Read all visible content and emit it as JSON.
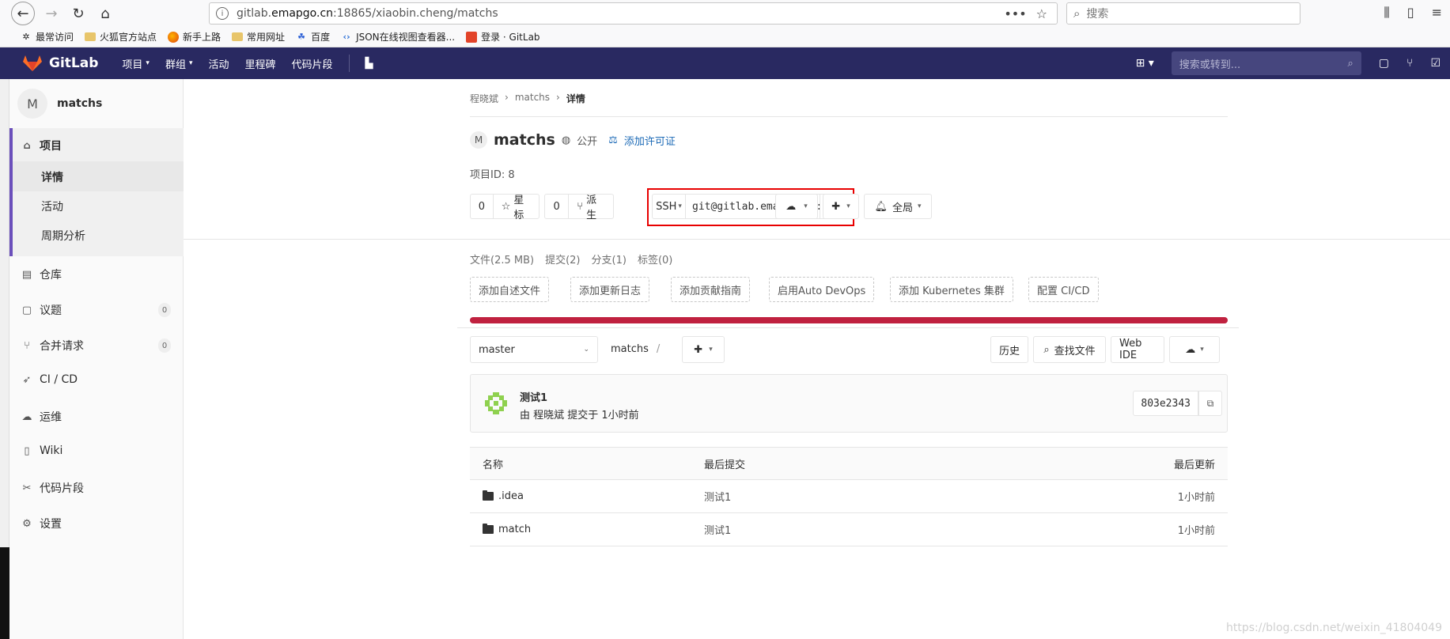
{
  "browser": {
    "url_prefix": "gitlab.",
    "url_host": "emapgo.cn",
    "url_rest": ":18865/xiaobin.cheng/matchs",
    "search_placeholder": "搜索",
    "bookmarks": [
      "最常访问",
      "火狐官方站点",
      "新手上路",
      "常用网址",
      "百度",
      "JSON在线视图查看器...",
      "登录 · GitLab"
    ]
  },
  "gitlab": {
    "brand": "GitLab",
    "menu": [
      "项目",
      "群组",
      "活动",
      "里程碑",
      "代码片段"
    ],
    "search_placeholder": "搜索或转到..."
  },
  "sidebar": {
    "project_initial": "M",
    "project_name": "matchs",
    "section": "项目",
    "sub_items": [
      "详情",
      "活动",
      "周期分析"
    ],
    "items": [
      {
        "label": "仓库"
      },
      {
        "label": "议题",
        "count": "0"
      },
      {
        "label": "合并请求",
        "count": "0"
      },
      {
        "label": "CI / CD"
      },
      {
        "label": "运维"
      },
      {
        "label": "Wiki"
      },
      {
        "label": "代码片段"
      },
      {
        "label": "设置"
      }
    ]
  },
  "breadcrumb": [
    "程晓斌",
    "matchs",
    "详情"
  ],
  "project": {
    "initial": "M",
    "name": "matchs",
    "visibility": "公开",
    "license_link": "添加许可证",
    "id_label": "项目ID:",
    "id": "8"
  },
  "actions": {
    "star_count": "0",
    "star_label": "星标",
    "fork_count": "0",
    "fork_label": "派生",
    "protocol": "SSH",
    "clone_url": "git@gitlab.emapgo.cn:xiaobin.cheng/matchs.git",
    "notify_label": "全局"
  },
  "stats": [
    "文件(2.5 MB)",
    "提交(2)",
    "分支(1)",
    "标签(0)"
  ],
  "quick_buttons": [
    "添加自述文件",
    "添加更新日志",
    "添加贡献指南",
    "启用Auto DevOps",
    "添加 Kubernetes 集群",
    "配置 CI/CD"
  ],
  "repo": {
    "branch": "master",
    "path": "matchs",
    "history": "历史",
    "find_file": "查找文件",
    "web_ide": "Web IDE"
  },
  "commit": {
    "title": "测试1",
    "meta": "由 程晓斌 提交于 1小时前",
    "sha": "803e2343"
  },
  "table": {
    "headers": [
      "名称",
      "最后提交",
      "最后更新"
    ],
    "rows": [
      {
        "name": ".idea",
        "commit": "测试1",
        "updated": "1小时前"
      },
      {
        "name": "match",
        "commit": "测试1",
        "updated": "1小时前"
      }
    ]
  },
  "watermark": "https://blog.csdn.net/weixin_41804049"
}
